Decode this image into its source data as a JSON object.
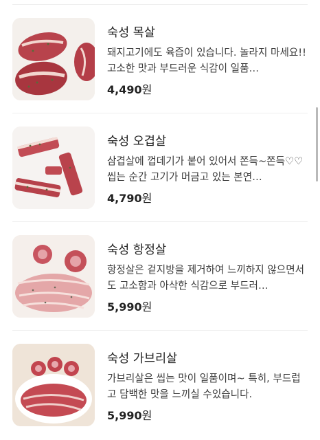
{
  "products": [
    {
      "name": "숙성 목살",
      "description": "돼지고기에도 육즙이 있습니다. 놀라지 마세요!! 고소한 맛과 부드러운 식감이 일품…",
      "price": "4,490",
      "currency": "원",
      "image_icon": "pork-neck-photo"
    },
    {
      "name": "숙성 오겹살",
      "description": "삼겹살에 껍데기가 붙어 있어서 쫀득~쫀득♡♡ 씹는 순간 고기가 머금고 있는 본연…",
      "price": "4,790",
      "currency": "원",
      "image_icon": "pork-belly-skin-photo"
    },
    {
      "name": "숙성 항정살",
      "description": "항정살은 겉지방을 제거하여 느끼하지 않으면서도 고소함과 아삭한 식감으로 부드러…",
      "price": "5,990",
      "currency": "원",
      "image_icon": "pork-jowl-photo"
    },
    {
      "name": "숙성 가브리살",
      "description": "가브리살은 씹는 맛이 일품이며~ 특히, 부드럽고 담백한 맛을 느끼실 수있습니다.",
      "price": "5,990",
      "currency": "원",
      "image_icon": "pork-gabri-photo"
    }
  ],
  "colors": {
    "meat": "#b5404a",
    "fat": "#f1d9d3",
    "background": "#ffffff",
    "price": "#222222"
  }
}
